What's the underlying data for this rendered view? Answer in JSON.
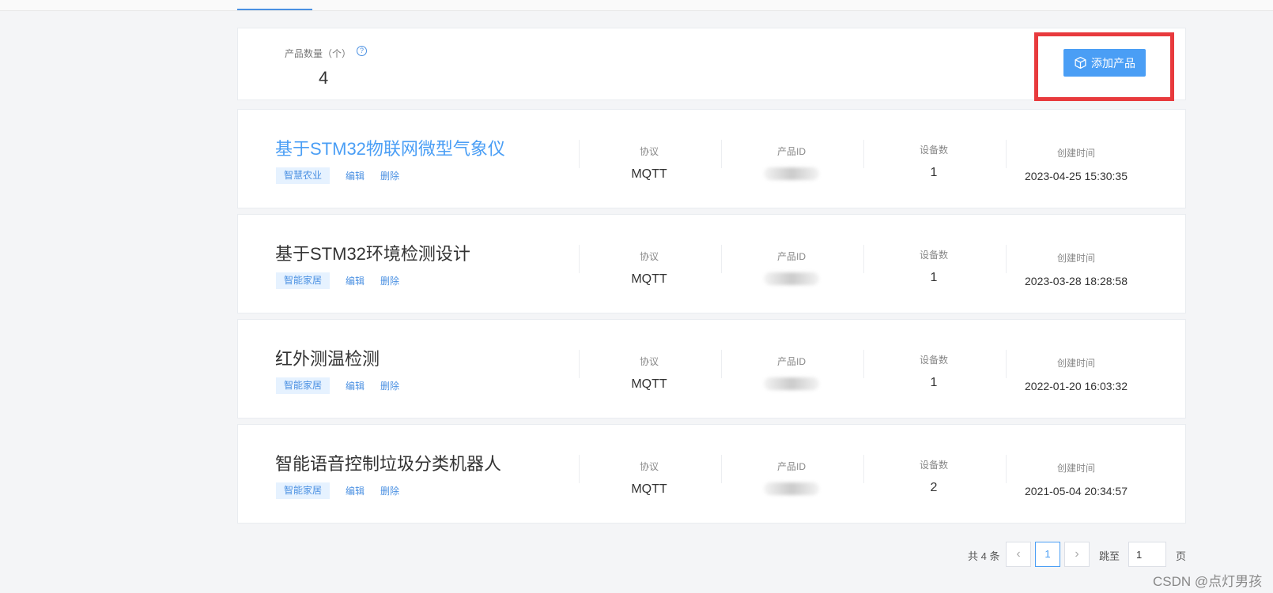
{
  "summary": {
    "count_label": "产品数量（个）",
    "help_icon": "?",
    "count_value": "4",
    "add_button": "添加产品"
  },
  "columns": {
    "protocol": "协议",
    "product_id": "产品ID",
    "devices": "设备数",
    "created": "创建时间"
  },
  "actions": {
    "edit": "编辑",
    "delete": "删除"
  },
  "products": [
    {
      "name": "基于STM32物联网微型气象仪",
      "tag": "智慧农业",
      "protocol": "MQTT",
      "devices": "1",
      "created": "2023-04-25 15:30:35"
    },
    {
      "name": "基于STM32环境检测设计",
      "tag": "智能家居",
      "protocol": "MQTT",
      "devices": "1",
      "created": "2023-03-28 18:28:58"
    },
    {
      "name": "红外测温检测",
      "tag": "智能家居",
      "protocol": "MQTT",
      "devices": "1",
      "created": "2022-01-20 16:03:32"
    },
    {
      "name": "智能语音控制垃圾分类机器人",
      "tag": "智能家居",
      "protocol": "MQTT",
      "devices": "2",
      "created": "2021-05-04 20:34:57"
    }
  ],
  "pagination": {
    "total": "共 4 条",
    "prev": "‹",
    "current": "1",
    "next": "›",
    "jump_to": "跳至",
    "jump_value": "1",
    "page_unit": "页"
  },
  "watermark": "CSDN @点灯男孩",
  "colors": {
    "accent": "#4a9ef5",
    "highlight": "#e83a3d",
    "tag_bg": "#e6f2ff"
  }
}
